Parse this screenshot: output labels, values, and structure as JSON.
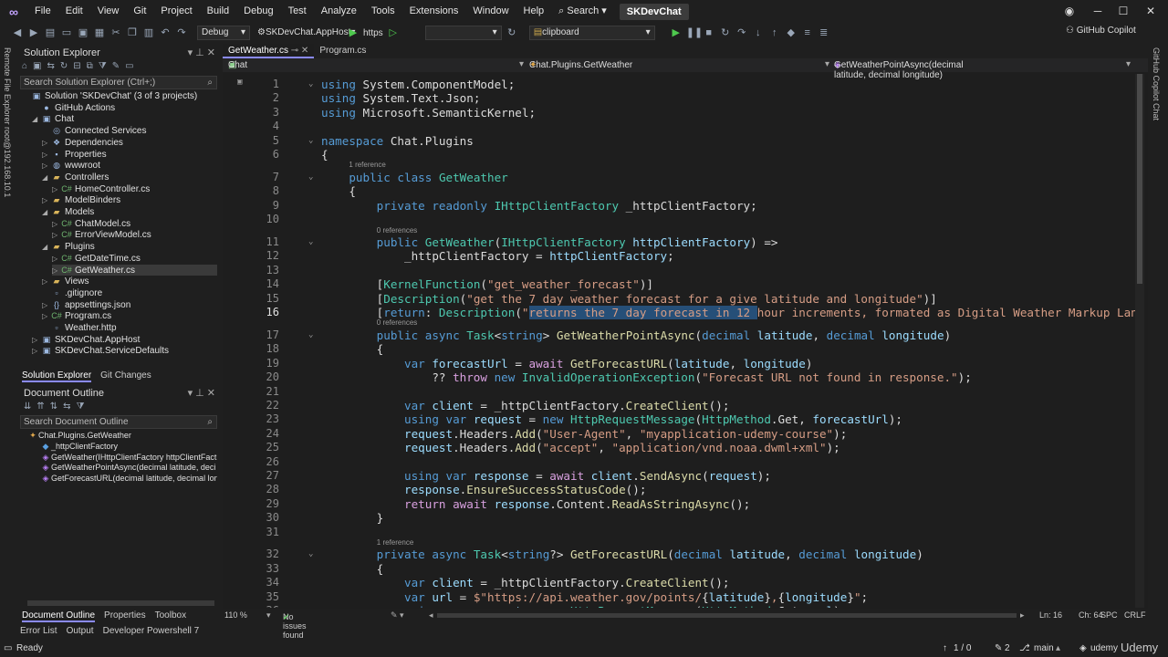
{
  "menu": {
    "items": [
      "File",
      "Edit",
      "View",
      "Git",
      "Project",
      "Build",
      "Debug",
      "Test",
      "Analyze",
      "Tools",
      "Extensions",
      "Window",
      "Help"
    ],
    "search": "Search",
    "solution_badge": "SKDevChat"
  },
  "toolbar": {
    "config": "Debug",
    "startup": "SKDevChat.AppHost",
    "launch": "https",
    "find": "clipboard",
    "copilot": "GitHub Copilot"
  },
  "left_strip": {
    "label": "Remote File Explorer root@192.168.10.1"
  },
  "right_strip": {
    "label": "GitHub Copilot Chat"
  },
  "solution_explorer": {
    "title": "Solution Explorer",
    "search_placeholder": "Search Solution Explorer (Ctrl+;)",
    "items": [
      {
        "label": "Solution 'SKDevChat' (3 of 3 projects)",
        "level": 0,
        "exp": "",
        "icon": "▣"
      },
      {
        "label": "GitHub Actions",
        "level": 1,
        "exp": "",
        "icon": "●"
      },
      {
        "label": "Chat",
        "level": 1,
        "exp": "◢",
        "icon": "▣"
      },
      {
        "label": "Connected Services",
        "level": 2,
        "exp": "",
        "icon": "◎"
      },
      {
        "label": "Dependencies",
        "level": 2,
        "exp": "▷",
        "icon": "❖"
      },
      {
        "label": "Properties",
        "level": 2,
        "exp": "▷",
        "icon": "▪"
      },
      {
        "label": "wwwroot",
        "level": 2,
        "exp": "▷",
        "icon": "◍"
      },
      {
        "label": "Controllers",
        "level": 2,
        "exp": "◢",
        "icon": "▰"
      },
      {
        "label": "HomeController.cs",
        "level": 3,
        "exp": "▷",
        "icon": "C#"
      },
      {
        "label": "ModelBinders",
        "level": 2,
        "exp": "▷",
        "icon": "▰"
      },
      {
        "label": "Models",
        "level": 2,
        "exp": "◢",
        "icon": "▰"
      },
      {
        "label": "ChatModel.cs",
        "level": 3,
        "exp": "▷",
        "icon": "C#"
      },
      {
        "label": "ErrorViewModel.cs",
        "level": 3,
        "exp": "▷",
        "icon": "C#"
      },
      {
        "label": "Plugins",
        "level": 2,
        "exp": "◢",
        "icon": "▰"
      },
      {
        "label": "GetDateTime.cs",
        "level": 3,
        "exp": "▷",
        "icon": "C#"
      },
      {
        "label": "GetWeather.cs",
        "level": 3,
        "exp": "▷",
        "icon": "C#"
      },
      {
        "label": "Views",
        "level": 2,
        "exp": "▷",
        "icon": "▰"
      },
      {
        "label": ".gitignore",
        "level": 2,
        "exp": "",
        "icon": "▫"
      },
      {
        "label": "appsettings.json",
        "level": 2,
        "exp": "▷",
        "icon": "{}"
      },
      {
        "label": "Program.cs",
        "level": 2,
        "exp": "▷",
        "icon": "C#"
      },
      {
        "label": "Weather.http",
        "level": 2,
        "exp": "",
        "icon": "▫"
      },
      {
        "label": "SKDevChat.AppHost",
        "level": 1,
        "exp": "▷",
        "icon": "▣"
      },
      {
        "label": "SKDevChat.ServiceDefaults",
        "level": 1,
        "exp": "▷",
        "icon": "▣"
      }
    ],
    "tabs": [
      "Solution Explorer",
      "Git Changes"
    ]
  },
  "document_outline": {
    "title": "Document Outline",
    "search_placeholder": "Search Document Outline",
    "items": [
      {
        "label": "Chat.Plugins.GetWeather",
        "level": 0
      },
      {
        "label": "_httpClientFactory",
        "level": 1
      },
      {
        "label": "GetWeather(IHttpClientFactory httpClientFact",
        "level": 1
      },
      {
        "label": "GetWeatherPointAsync(decimal latitude, deci",
        "level": 1
      },
      {
        "label": "GetForecastURL(decimal latitude, decimal lon",
        "level": 1
      }
    ],
    "tabs": [
      "Document Outline",
      "Properties",
      "Toolbox"
    ]
  },
  "bottom_panel_tabs": [
    "Error List",
    "Output",
    "Developer Powershell 7"
  ],
  "editor": {
    "tabs": [
      "GetWeather.cs",
      "Program.cs"
    ],
    "nav": {
      "project": "Chat",
      "type": "Chat.Plugins.GetWeather",
      "member": "GetWeatherPointAsync(decimal latitude, decimal longitude)"
    },
    "references": [
      {
        "before_line": 7,
        "text": "1 reference"
      },
      {
        "before_line": 11,
        "text": "0 references"
      },
      {
        "before_line": 17,
        "text": "0 references"
      },
      {
        "before_line": 32,
        "text": "1 reference"
      }
    ],
    "lines": [
      {
        "n": 1,
        "html": "<span class='kw'>using</span> System.ComponentModel;"
      },
      {
        "n": 2,
        "html": "<span class='kw'>using</span> System.Text.Json;"
      },
      {
        "n": 3,
        "html": "<span class='kw'>using</span> Microsoft.SemanticKernel;"
      },
      {
        "n": 4,
        "html": ""
      },
      {
        "n": 5,
        "html": "<span class='kw'>namespace</span> Chat.Plugins"
      },
      {
        "n": 6,
        "html": "{"
      },
      {
        "n": 7,
        "html": "    <span class='kw'>public class</span> <span class='ty'>GetWeather</span>"
      },
      {
        "n": 8,
        "html": "    {"
      },
      {
        "n": 9,
        "html": "        <span class='kw'>private readonly</span> <span class='ty'>IHttpClientFactory</span> _httpClientFactory;"
      },
      {
        "n": 10,
        "html": ""
      },
      {
        "n": 11,
        "html": "        <span class='kw'>public</span> <span class='ty'>GetWeather</span>(<span class='ty'>IHttpClientFactory</span> <span class='pr'>httpClientFactory</span>) =>"
      },
      {
        "n": 12,
        "html": "            _httpClientFactory = <span class='pr'>httpClientFactory</span>;"
      },
      {
        "n": 13,
        "html": ""
      },
      {
        "n": 14,
        "html": "        [<span class='ty'>KernelFunction</span>(<span class='str'>\"get_weather_forecast\"</span>)]"
      },
      {
        "n": 15,
        "html": "        [<span class='ty'>Description</span>(<span class='str'>\"get the 7 day weather forecast for a give latitude and longitude\"</span>)]"
      },
      {
        "n": 16,
        "html": "        [<span class='kw'>return</span>: <span class='ty'>Description</span>(<span class='str'>\"<span class='sel'>returns the 7 day forecast in 12 </span>hour increments, formated as Digital Weather Markup Language</span>"
      },
      {
        "n": 17,
        "html": "        <span class='kw'>public async</span> <span class='ty'>Task</span>&lt;<span class='kw'>string</span>&gt; <span class='fn'>GetWeatherPointAsync</span>(<span class='kw'>decimal</span> <span class='pr'>latitude</span>, <span class='kw'>decimal</span> <span class='pr'>longitude</span>)"
      },
      {
        "n": 18,
        "html": "        {"
      },
      {
        "n": 19,
        "html": "            <span class='kw'>var</span> <span class='pr'>forecastUrl</span> = <span class='ctl'>await</span> <span class='fn'>GetForecastURL</span>(<span class='pr'>latitude</span>, <span class='pr'>longitude</span>)"
      },
      {
        "n": 20,
        "html": "                ?? <span class='ctl'>throw</span> <span class='kw'>new</span> <span class='ty'>InvalidOperationException</span>(<span class='str'>\"Forecast URL not found in response.\"</span>);"
      },
      {
        "n": 21,
        "html": ""
      },
      {
        "n": 22,
        "html": "            <span class='kw'>var</span> <span class='pr'>client</span> = _httpClientFactory.<span class='fn'>CreateClient</span>();"
      },
      {
        "n": 23,
        "html": "            <span class='kw'>using var</span> <span class='pr'>request</span> = <span class='kw'>new</span> <span class='ty'>HttpRequestMessage</span>(<span class='ty'>HttpMethod</span>.Get, <span class='pr'>forecastUrl</span>);"
      },
      {
        "n": 24,
        "html": "            <span class='pr'>request</span>.Headers.<span class='fn'>Add</span>(<span class='str'>\"User-Agent\"</span>, <span class='str'>\"myapplication-udemy-course\"</span>);"
      },
      {
        "n": 25,
        "html": "            <span class='pr'>request</span>.Headers.<span class='fn'>Add</span>(<span class='str'>\"accept\"</span>, <span class='str'>\"application/vnd.noaa.dwml+xml\"</span>);"
      },
      {
        "n": 26,
        "html": ""
      },
      {
        "n": 27,
        "html": "            <span class='kw'>using var</span> <span class='pr'>response</span> = <span class='ctl'>await</span> <span class='pr'>client</span>.<span class='fn'>SendAsync</span>(<span class='pr'>request</span>);"
      },
      {
        "n": 28,
        "html": "            <span class='pr'>response</span>.<span class='fn'>EnsureSuccessStatusCode</span>();"
      },
      {
        "n": 29,
        "html": "            <span class='ctl'>return await</span> <span class='pr'>response</span>.Content.<span class='fn'>ReadAsStringAsync</span>();"
      },
      {
        "n": 30,
        "html": "        }"
      },
      {
        "n": 31,
        "html": ""
      },
      {
        "n": 32,
        "html": "        <span class='kw'>private async</span> <span class='ty'>Task</span>&lt;<span class='kw'>string</span>?&gt; <span class='fn'>GetForecastURL</span>(<span class='kw'>decimal</span> <span class='pr'>latitude</span>, <span class='kw'>decimal</span> <span class='pr'>longitude</span>)"
      },
      {
        "n": 33,
        "html": "        {"
      },
      {
        "n": 34,
        "html": "            <span class='kw'>var</span> <span class='pr'>client</span> = _httpClientFactory.<span class='fn'>CreateClient</span>();"
      },
      {
        "n": 35,
        "html": "            <span class='kw'>var</span> <span class='pr'>url</span> = <span class='str'>$\"https://api.weather.gov/points/</span>{<span class='pr'>latitude</span>}<span class='str'>,</span>{<span class='pr'>longitude</span>}<span class='str'>\"</span>;"
      },
      {
        "n": 36,
        "html": "            <span class='kw'>using var</span> <span class='pr'>request</span> = <span class='kw'>new</span> <span class='ty'>HttpRequestMessage</span>(<span class='ty'>HttpMethod</span>.Get, <span class='pr'>url</span>);"
      }
    ],
    "current_line": 16,
    "fold_lines": [
      1,
      5,
      7,
      11,
      17,
      32
    ]
  },
  "editor_status": {
    "zoom": "110 %",
    "issues": "No issues found",
    "position": "Ln: 16",
    "column": "Ch: 64",
    "whitespace": "SPC",
    "line_endings": "CRLF"
  },
  "statusbar": {
    "ready": "Ready",
    "counter": "1 / 0",
    "pencil_count": "2",
    "branch": "main",
    "repo": "udemy",
    "brand": "Udemy"
  }
}
